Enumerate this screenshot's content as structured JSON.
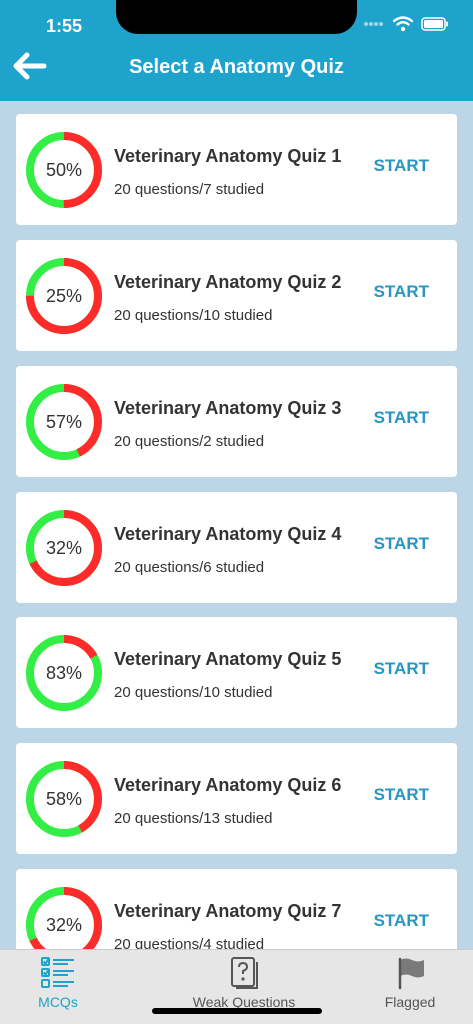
{
  "status_bar": {
    "time": "1:55"
  },
  "header": {
    "title": "Select a Anatomy Quiz"
  },
  "colors": {
    "header": "#1ea3cd",
    "background": "#bcd6e8",
    "progress_done": "#33ee44",
    "progress_remaining": "#ff2a2a",
    "start": "#2796c3",
    "tab_active": "#1ea3cd",
    "tab_inactive": "#555555"
  },
  "quizzes": [
    {
      "percent_label": "50%",
      "percent": 50,
      "title": "Veterinary Anatomy Quiz 1",
      "meta": "20 questions/7 studied",
      "action": "START"
    },
    {
      "percent_label": "25%",
      "percent": 25,
      "title": "Veterinary Anatomy Quiz 2",
      "meta": "20 questions/10 studied",
      "action": "START"
    },
    {
      "percent_label": "57%",
      "percent": 57,
      "title": "Veterinary Anatomy Quiz 3",
      "meta": "20 questions/2 studied",
      "action": "START"
    },
    {
      "percent_label": "32%",
      "percent": 32,
      "title": "Veterinary Anatomy Quiz 4",
      "meta": "20 questions/6 studied",
      "action": "START"
    },
    {
      "percent_label": "83%",
      "percent": 83,
      "title": "Veterinary Anatomy Quiz 5",
      "meta": "20 questions/10 studied",
      "action": "START"
    },
    {
      "percent_label": "58%",
      "percent": 58,
      "title": "Veterinary Anatomy Quiz 6",
      "meta": "20 questions/13 studied",
      "action": "START"
    },
    {
      "percent_label": "32%",
      "percent": 32,
      "title": "Veterinary Anatomy Quiz 7",
      "meta": "20 questions/4 studied",
      "action": "START"
    }
  ],
  "tabs": [
    {
      "label": "MCQs",
      "icon": "checklist-icon",
      "active": true
    },
    {
      "label": "Weak Questions",
      "icon": "question-card-icon",
      "active": false
    },
    {
      "label": "Flagged",
      "icon": "flag-icon",
      "active": false
    }
  ]
}
